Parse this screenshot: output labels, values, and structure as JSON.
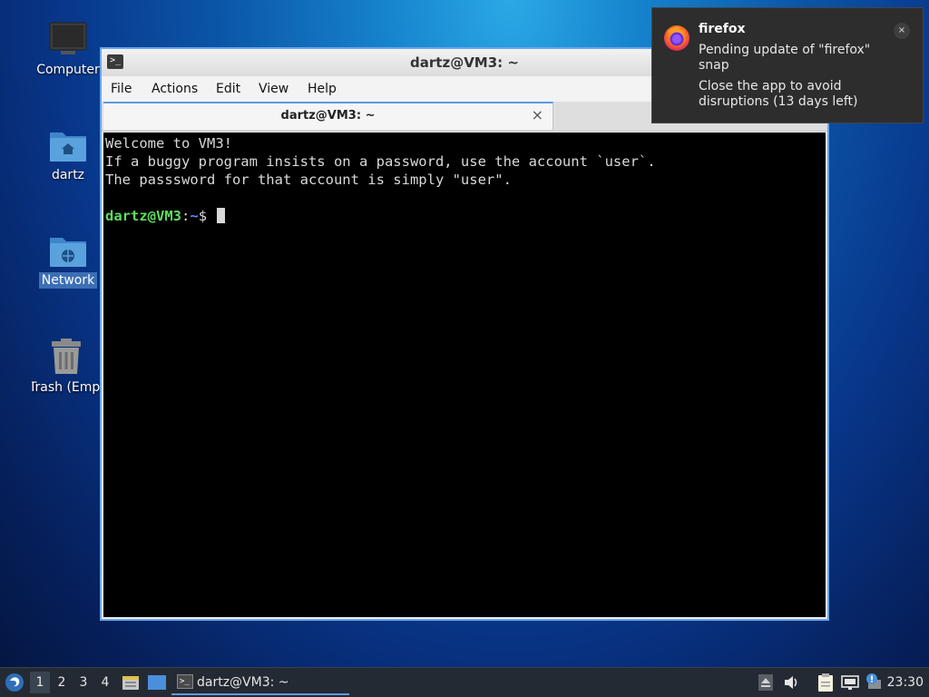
{
  "desktop": {
    "icons": [
      {
        "label": "Computer"
      },
      {
        "label": "dartz"
      },
      {
        "label": "Network"
      },
      {
        "label": "Trash (Empty)"
      }
    ]
  },
  "window": {
    "title": "dartz@VM3: ~",
    "menu": [
      "File",
      "Actions",
      "Edit",
      "View",
      "Help"
    ],
    "tab": {
      "label": "dartz@VM3: ~",
      "close_glyph": "×"
    },
    "terminal": {
      "lines": [
        "Welcome to VM3!",
        "If a buggy program insists on a password, use the account `user`.",
        "The passsword for that account is simply \"user\"."
      ],
      "prompt_user": "dartz@VM3",
      "prompt_colon": ":",
      "prompt_path": "~",
      "prompt_symbol": "$ "
    }
  },
  "notification": {
    "app": "firefox",
    "close_glyph": "×",
    "line1": "Pending update of \"firefox\" snap",
    "line2": "Close the app to avoid disruptions (13 days left)"
  },
  "taskbar": {
    "workspaces": [
      "1",
      "2",
      "3",
      "4"
    ],
    "active_workspace": "1",
    "task_label": "dartz@VM3: ~",
    "clock": "23:30"
  },
  "colors": {
    "accent": "#5c9ae0",
    "prompt_user": "#5be05b",
    "prompt_path": "#5b8cff",
    "taskbar_bg": "#242a33"
  }
}
